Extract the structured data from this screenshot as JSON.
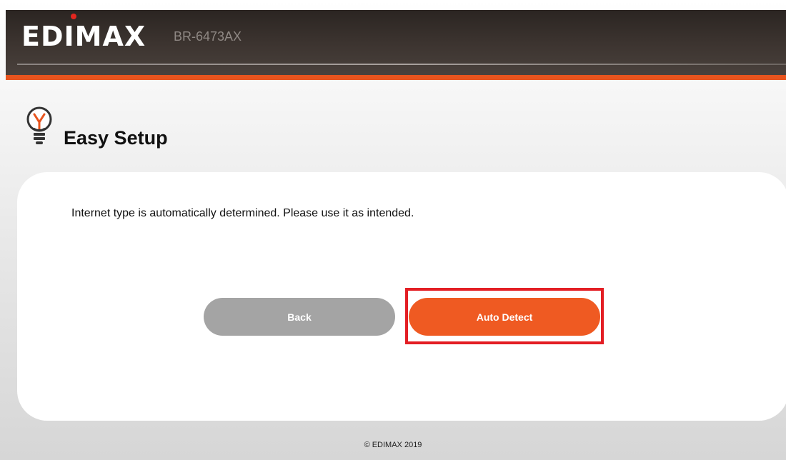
{
  "header": {
    "brand": "EDIMAX",
    "model": "BR-6473AX",
    "accent_color": "#e8541e",
    "logo_dot_color": "#e3261f"
  },
  "page": {
    "title": "Easy Setup",
    "title_icon": "lightbulb-icon"
  },
  "card": {
    "message": "Internet type is automatically determined. Please use it as intended.",
    "back_label": "Back",
    "detect_label": "Auto Detect",
    "back_color": "#a4a4a4",
    "detect_color": "#ef5a22",
    "highlight_color": "#e31e24"
  },
  "footer": {
    "copyright": "© EDIMAX 2019"
  }
}
